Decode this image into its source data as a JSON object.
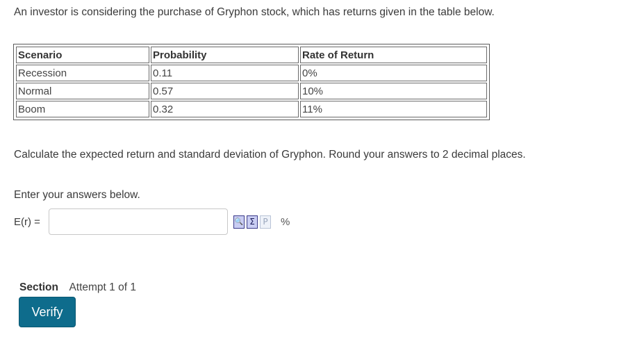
{
  "question": {
    "intro": "An investor is considering the purchase of Gryphon stock, which has returns given in the table below.",
    "instructions": "Calculate the expected return and standard deviation of Gryphon. Round your answers to 2 decimal places."
  },
  "table": {
    "headers": [
      "Scenario",
      "Probability",
      "Rate of Return"
    ],
    "rows": [
      [
        "Recession",
        "0.11",
        "0%"
      ],
      [
        "Normal",
        "0.57",
        "10%"
      ],
      [
        "Boom",
        "0.32",
        "11%"
      ]
    ]
  },
  "answer": {
    "prompt": "Enter your answers below.",
    "er_label": "E(r) =",
    "er_value": "",
    "unit": "%",
    "tools": [
      {
        "icon": "preview-icon",
        "glyph": "🔍",
        "enabled": true
      },
      {
        "icon": "equation-editor-icon",
        "glyph": "Σ",
        "enabled": true
      },
      {
        "icon": "palette-icon",
        "glyph": "P",
        "enabled": false
      }
    ]
  },
  "footer": {
    "section_label": "Section",
    "attempt_text": "Attempt 1 of 1",
    "verify_label": "Verify"
  }
}
